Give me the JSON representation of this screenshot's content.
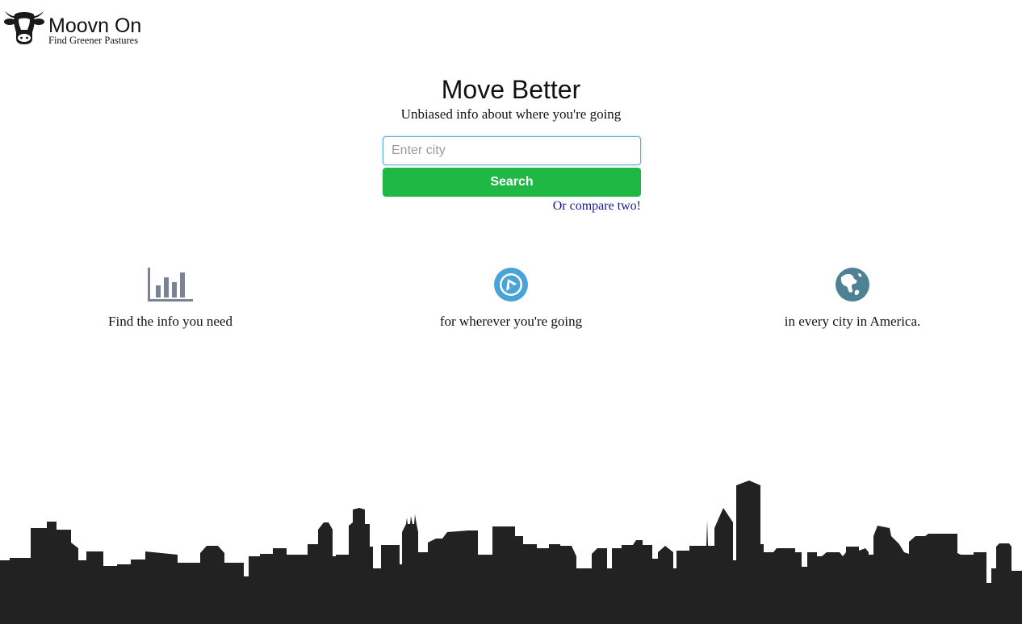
{
  "brand": {
    "name": "Moovn On",
    "tagline": "Find Greener Pastures",
    "icon": "cow-head-icon"
  },
  "hero": {
    "title": "Move Better",
    "subtitle": "Unbiased info about where you're going"
  },
  "search": {
    "placeholder": "Enter city",
    "value": "",
    "button_label": "Search",
    "compare_link": "Or compare two!"
  },
  "features": [
    {
      "icon": "bar-chart-icon",
      "text": "Find the info you need"
    },
    {
      "icon": "compass-icon",
      "text": "for wherever you're going"
    },
    {
      "icon": "globe-icon",
      "text": "in every city in America."
    }
  ],
  "colors": {
    "search_button": "#1fb845",
    "input_border": "#5aa9d6",
    "link": "#1a1a8c",
    "chart_icon": "#7a8297",
    "compass_icon": "#4aa3d6",
    "globe_icon": "#4f8195",
    "skyline": "#222222"
  },
  "footer": {
    "decoration": "city-skyline-silhouette"
  }
}
